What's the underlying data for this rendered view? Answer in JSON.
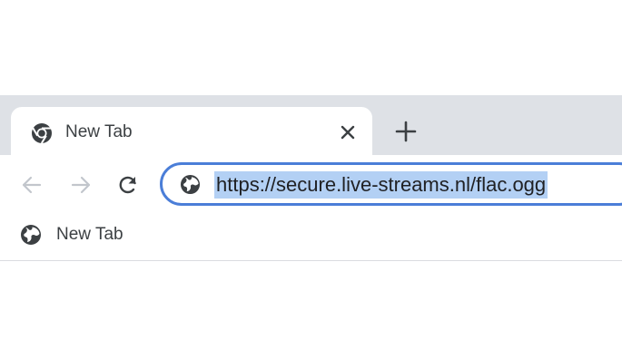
{
  "tab": {
    "title": "New Tab",
    "favicon": "chrome-logo-icon"
  },
  "toolbar": {
    "back_icon": "arrow-left-icon",
    "forward_icon": "arrow-right-icon",
    "reload_icon": "reload-icon"
  },
  "omnibox": {
    "url": "https://secure.live-streams.nl/flac.ogg",
    "site_icon": "globe-icon",
    "selected": true
  },
  "bookmarks": [
    {
      "label": "New Tab",
      "icon": "globe-icon"
    }
  ],
  "colors": {
    "accent": "#4b7ed8",
    "selection": "#b3d0f4",
    "tabstrip": "#dee1e6"
  }
}
